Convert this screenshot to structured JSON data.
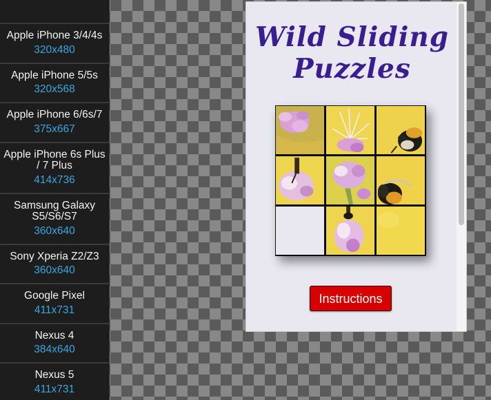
{
  "sidebar": {
    "devices": [
      {
        "name": "Apple iPhone 3/4/4s",
        "res": "320x480"
      },
      {
        "name": "Apple iPhone 5/5s",
        "res": "320x568"
      },
      {
        "name": "Apple iPhone 6/6s/7",
        "res": "375x667"
      },
      {
        "name": "Apple iPhone 6s Plus / 7 Plus",
        "res": "414x736"
      },
      {
        "name": "Samsung Galaxy S5/S6/S7",
        "res": "360x640"
      },
      {
        "name": "Sony Xperia Z2/Z3",
        "res": "360x640"
      },
      {
        "name": "Google Pixel",
        "res": "411x731"
      },
      {
        "name": "Nexus 4",
        "res": "384x640"
      },
      {
        "name": "Nexus 5",
        "res": "411x731"
      }
    ]
  },
  "app": {
    "title_line1": "Wild Sliding",
    "title_line2": "Puzzles",
    "instructions_label": "Instructions",
    "colors": {
      "title": "#3a1d8f",
      "button": "#d60000",
      "tile_yellow": "#f2d447",
      "tile_pink": "#d9a0d6"
    }
  },
  "puzzle": {
    "tiles": [
      {
        "name": "tile-1",
        "content": "pink-flower"
      },
      {
        "name": "tile-2",
        "content": "yellow-flower-stamens"
      },
      {
        "name": "tile-3",
        "content": "bumblebee"
      },
      {
        "name": "tile-4",
        "content": "flower-cluster"
      },
      {
        "name": "tile-5",
        "content": "pink-flower-head"
      },
      {
        "name": "tile-6",
        "content": "bee-abdomen"
      },
      {
        "name": "tile-7",
        "content": "empty"
      },
      {
        "name": "tile-8",
        "content": "flower-stem"
      },
      {
        "name": "tile-9",
        "content": "yellow-background"
      }
    ]
  }
}
